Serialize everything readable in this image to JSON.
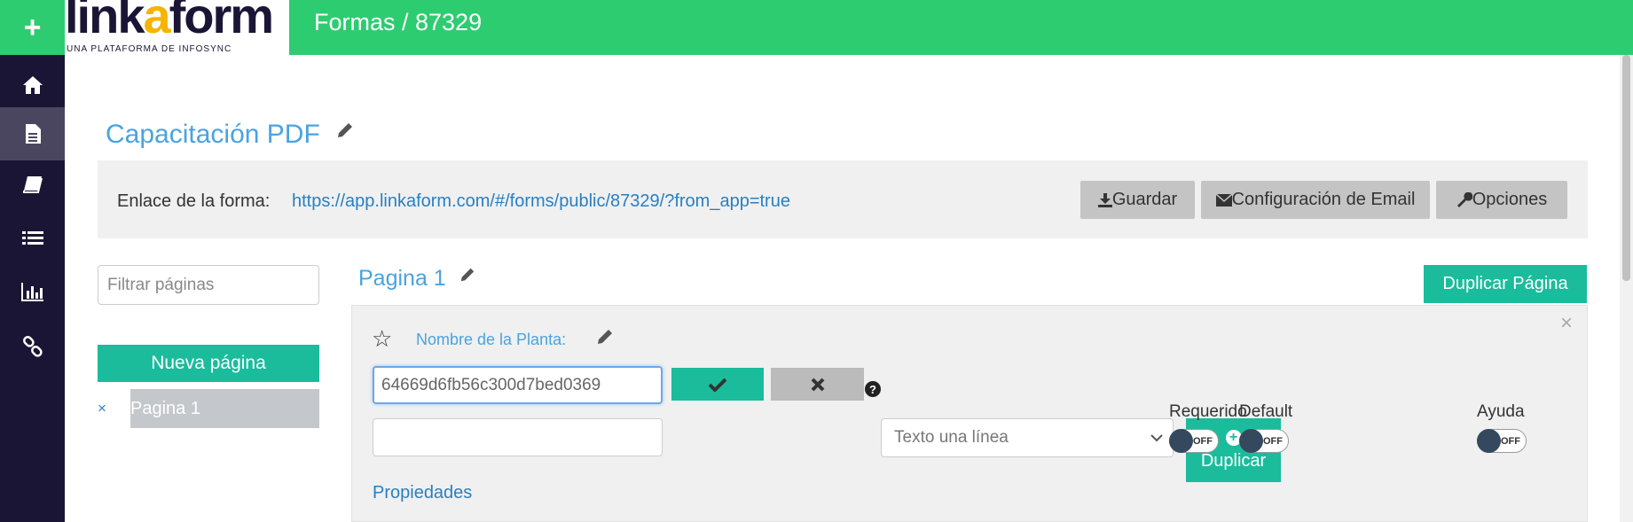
{
  "sidebar": {
    "add_icon": "plus-icon",
    "items": [
      {
        "icon": "home-icon",
        "active": false
      },
      {
        "icon": "document-icon",
        "active": true
      },
      {
        "icon": "book-icon",
        "active": false
      },
      {
        "icon": "list-icon",
        "active": false
      },
      {
        "icon": "bar-chart-icon",
        "active": false
      },
      {
        "icon": "link-icon",
        "active": false
      }
    ]
  },
  "brand": {
    "logo_pre": "link",
    "logo_accent": "a",
    "logo_post": "form",
    "tagline": "UNA PLATAFORMA DE INFOSYNC"
  },
  "header": {
    "title": "Formas / 87329"
  },
  "form": {
    "title": "Capacitación PDF",
    "link_label": "Enlace de la forma:",
    "link_url": "https://app.linkaform.com/#/forms/public/87329/?from_app=true",
    "buttons": {
      "save": "Guardar",
      "email_config": "Configuración de Email",
      "options": "Opciones"
    }
  },
  "pages_panel": {
    "filter_placeholder": "Filtrar páginas",
    "new_page": "Nueva página",
    "remove_symbol": "×",
    "pages": [
      "Pagina 1"
    ]
  },
  "page": {
    "title": "Pagina 1",
    "duplicate_page": "Duplicar Página"
  },
  "field": {
    "label": "Nombre de la Planta:",
    "id_value": "64669d6fb56c300d7bed0369",
    "second_value": "",
    "type_selected": "Texto una línea",
    "duplicate": "Duplicar",
    "toggles": [
      {
        "label": "Requerido",
        "state": "OFF"
      },
      {
        "label": "Default",
        "state": "OFF"
      },
      {
        "label": "Ayuda",
        "state": "OFF"
      }
    ],
    "properties_link": "Propiedades",
    "help_symbol": "?"
  },
  "colors": {
    "brand_green": "#2ecc71",
    "teal": "#1abc9c",
    "sidebar_bg": "#1b1535",
    "title_blue": "#4aa3df",
    "link_blue": "#2a7fc0"
  }
}
